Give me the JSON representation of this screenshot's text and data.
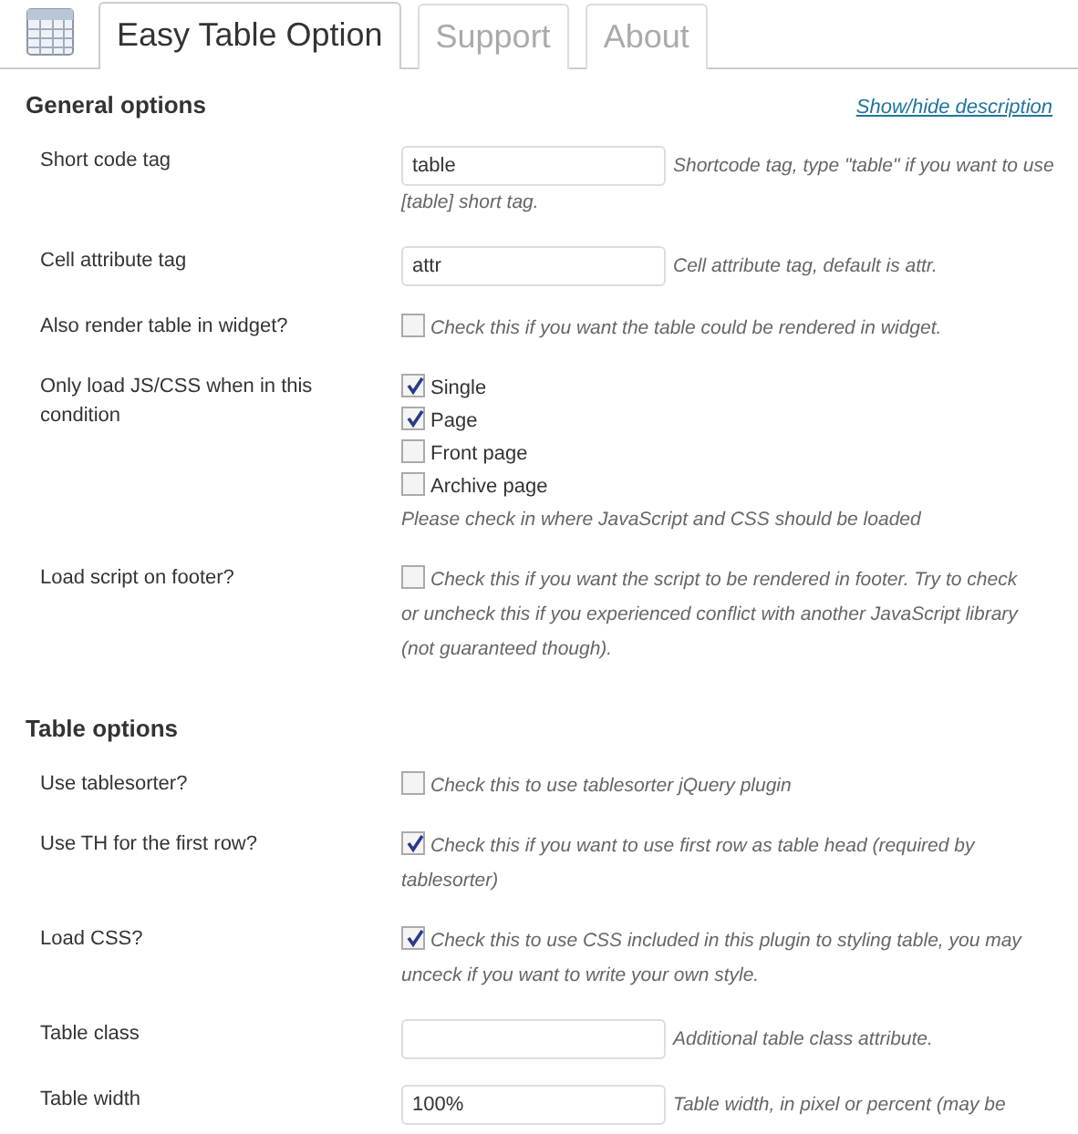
{
  "tabs": [
    {
      "label": "Easy Table Option",
      "selected": true
    },
    {
      "label": "Support",
      "selected": false
    },
    {
      "label": "About",
      "selected": false
    }
  ],
  "sections": [
    {
      "title": "General options",
      "link": "Show/hide description",
      "rows": [
        {
          "kind": "text",
          "label": "Short code tag",
          "value": "table",
          "description": [
            "Shortcode tag, type \"table\" if you want to use",
            "[table] short tag."
          ]
        },
        {
          "kind": "text",
          "label": "Cell attribute tag",
          "value": "attr",
          "description": [
            "Cell attribute tag, default is attr."
          ]
        },
        {
          "kind": "checkbox",
          "label": "Also render table in widget?",
          "checked": false,
          "description": [
            "Check this if you want the table could be rendered in widget."
          ]
        },
        {
          "kind": "checklist",
          "label": "Only load JS/CSS when in this condition",
          "options": [
            {
              "label": "Single",
              "checked": true
            },
            {
              "label": "Page",
              "checked": true
            },
            {
              "label": "Front page",
              "checked": false
            },
            {
              "label": "Archive page",
              "checked": false
            }
          ],
          "description": [
            "Please check in where JavaScript and CSS should be loaded"
          ]
        },
        {
          "kind": "checkbox",
          "label": "Load script on footer?",
          "checked": false,
          "description": [
            "Check this if you want the script to be rendered in footer. Try to check",
            "or uncheck this if you experienced conflict with another JavaScript library",
            "(not guaranteed though)."
          ]
        }
      ]
    },
    {
      "title": "Table options",
      "rows": [
        {
          "kind": "checkbox",
          "label": "Use tablesorter?",
          "checked": false,
          "description": [
            "Check this to use tablesorter jQuery plugin"
          ]
        },
        {
          "kind": "checkbox",
          "label": "Use TH for the first row?",
          "checked": true,
          "description": [
            "Check this if you want to use first row as table head (required by",
            "tablesorter)"
          ]
        },
        {
          "kind": "checkbox",
          "label": "Load CSS?",
          "checked": true,
          "description": [
            "Check this to use CSS included in this plugin to styling table, you may",
            "unceck if you want to write your own style."
          ]
        },
        {
          "kind": "text",
          "label": "Table class",
          "value": "",
          "description": [
            "Additional table class attribute."
          ]
        },
        {
          "kind": "text",
          "label": "Table width",
          "value": "100%",
          "description": [
            "Table width, in pixel or percent (may be"
          ]
        }
      ]
    }
  ]
}
